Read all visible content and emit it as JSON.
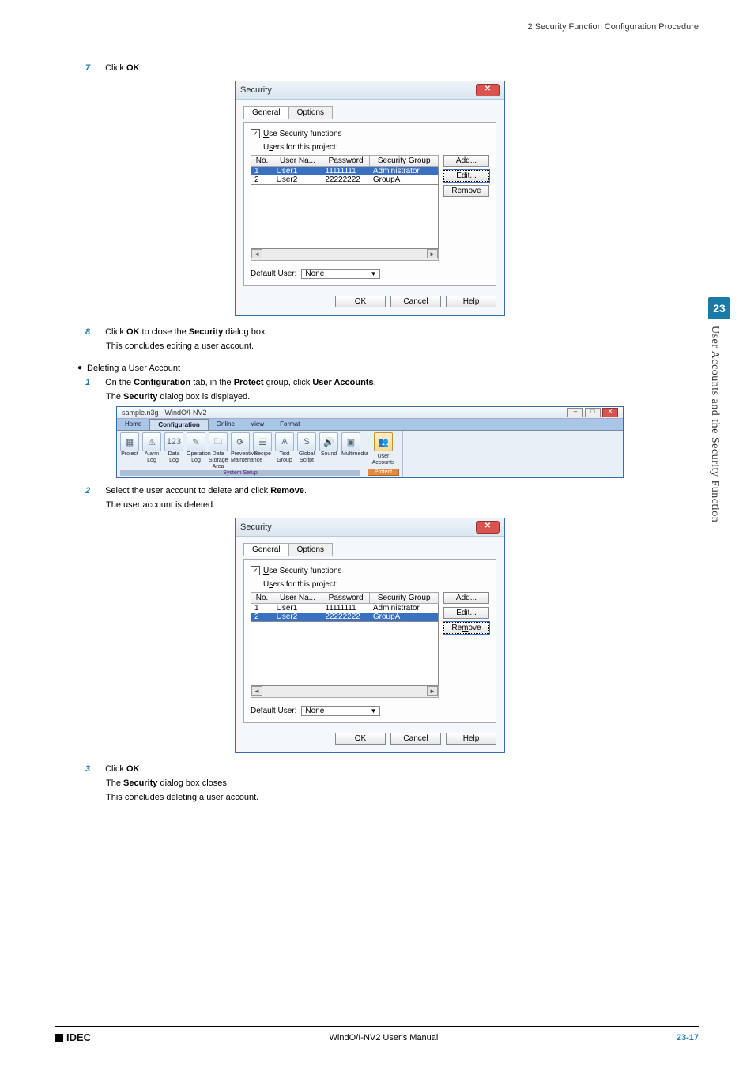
{
  "header": {
    "running": "2 Security Function Configuration Procedure"
  },
  "steps": {
    "s7": "Click ",
    "s7b": "OK",
    "s7c": ".",
    "s8": "Click ",
    "s8b": "OK",
    "s8c": " to close the ",
    "s8d": "Security",
    "s8e": " dialog box.",
    "s8f": "This concludes editing a user account.",
    "del_head": "Deleting a User Account",
    "d1a": "On the ",
    "d1b": "Configuration",
    "d1c": " tab, in the ",
    "d1d": "Protect",
    "d1e": " group, click ",
    "d1f": "User Accounts",
    "d1g": ".",
    "d1h": "The ",
    "d1i": "Security",
    "d1j": " dialog box is displayed.",
    "d2a": "Select the user account to delete and click ",
    "d2b": "Remove",
    "d2c": ".",
    "d2d": "The user account is deleted.",
    "d3a": "Click ",
    "d3b": "OK",
    "d3c": ".",
    "d3d": "The ",
    "d3e": "Security",
    "d3f": " dialog box closes.",
    "d3g": "This concludes deleting a user account."
  },
  "dialog": {
    "title": "Security",
    "tab_general": "General",
    "tab_options": "Options",
    "use_sec": "Use Security functions",
    "users_label": "Users for this project:",
    "col_no": "No.",
    "col_user": "User Na...",
    "col_pass": "Password",
    "col_group": "Security Group",
    "r1": {
      "no": "1",
      "user": "User1",
      "pass": "11111111",
      "group": "Administrator"
    },
    "r2": {
      "no": "2",
      "user": "User2",
      "pass": "22222222",
      "group": "GroupA"
    },
    "btn_add": "Add...",
    "btn_edit": "Edit...",
    "btn_remove": "Remove",
    "def_label": "Default User:",
    "def_val": "None",
    "ok": "OK",
    "cancel": "Cancel",
    "help": "Help"
  },
  "ribbon": {
    "window_title": "sample.n3g - WindO/I-NV2",
    "tabs": [
      "Home",
      "Configuration",
      "Online",
      "View",
      "Format"
    ],
    "g1": {
      "items": [
        "Project",
        "Alarm Log",
        "Data Log",
        "Operation Log",
        "Data Storage Area",
        "Preventive Maintenance",
        "Recipe",
        "Text Group",
        "Global Script",
        "Sound",
        "Multimedia",
        "User Accounts"
      ],
      "group_system": "System Setup",
      "group_protect": "Protect"
    }
  },
  "side": {
    "chapter_no": "23",
    "chapter_title": "User Accounts and the Security Function"
  },
  "footer": {
    "logo": "IDEC",
    "center": "WindO/I-NV2 User's Manual",
    "page": "23-17"
  },
  "nums": {
    "n7": "7",
    "n8": "8",
    "n1": "1",
    "n2": "2",
    "n3": "3"
  }
}
